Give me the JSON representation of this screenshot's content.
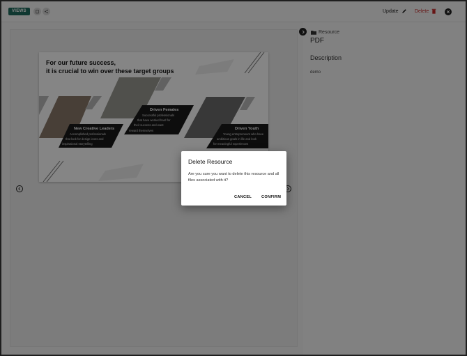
{
  "topbar": {
    "views_label": "VIEWS",
    "update_label": "Update",
    "delete_label": "Delete",
    "delete_color": "#c62828",
    "accent_color": "#1f6b5e",
    "icons": [
      "copy-icon",
      "share-icon",
      "pencil-icon",
      "trash-icon",
      "close-icon"
    ]
  },
  "slide": {
    "title_line1": "For our future success,",
    "title_line2": "it is crucial to win over these target groups",
    "groups": [
      {
        "heading": "New Creative Leaders",
        "lines": [
          "Accomplished professionals",
          "that look for design icons and",
          "inspirational storytelling"
        ]
      },
      {
        "heading": "Driven Females",
        "lines": [
          "Successful professionals",
          "that have worked hard for",
          "their success and want",
          "reward themselves"
        ]
      },
      {
        "heading": "Driven Youth",
        "lines": [
          "Young entrepreneurs who have",
          "ambitious goals in life and look",
          "for meaningful experiences"
        ]
      }
    ]
  },
  "panel": {
    "breadcrumb": "Resource",
    "resource_type": "PDF",
    "description_label": "Description",
    "description_value": "demo"
  },
  "dialog": {
    "title": "Delete Resource",
    "message": "Are you sure you want to delete this resource and all files associated with it?",
    "cancel_label": "CANCEL",
    "confirm_label": "CONFIRM"
  }
}
